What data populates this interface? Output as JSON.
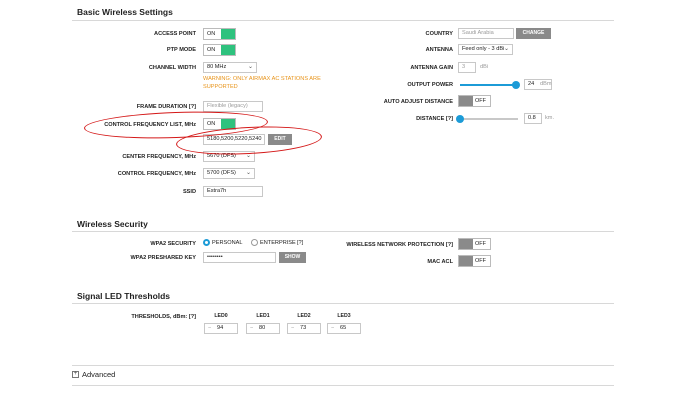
{
  "basic": {
    "title": "Basic Wireless Settings",
    "access_point_label": "ACCESS POINT",
    "access_point_state": "ON",
    "ptp_mode_label": "PTP MODE",
    "ptp_mode_state": "ON",
    "channel_width_label": "CHANNEL WIDTH",
    "channel_width_value": "80 MHz",
    "warning_line1": "WARNING: ONLY AIRMAX AC STATIONS ARE",
    "warning_line2": "SUPPORTED",
    "frame_duration_label": "FRAME DURATION [?]",
    "frame_duration_value": "Flexible (legacy)",
    "control_freq_list_label": "CONTROL FREQUENCY LIST, MHz",
    "control_freq_list_state": "ON",
    "control_freq_list_value": "5180,5200,5220,5240",
    "edit_label": "EDIT",
    "center_freq_label": "CENTER FREQUENCY, MHz",
    "center_freq_value": "5670 (DFS)",
    "control_freq_label": "CONTROL FREQUENCY, MHz",
    "control_freq_value": "5700 (DFS)",
    "ssid_label": "SSID",
    "ssid_value": "Estra7h",
    "country_label": "COUNTRY",
    "country_value": "Saudi Arabia",
    "change_label": "CHANGE",
    "antenna_label": "ANTENNA",
    "antenna_value": "Feed only - 3 dBi",
    "antenna_gain_label": "ANTENNA GAIN",
    "antenna_gain_value": "3",
    "antenna_gain_unit": "dBi",
    "output_power_label": "OUTPUT POWER",
    "output_power_value": "24",
    "output_power_unit": "dBm",
    "output_power_level": 0.96,
    "auto_adjust_label": "AUTO ADJUST DISTANCE",
    "auto_adjust_state": "OFF",
    "distance_label": "DISTANCE [?]",
    "distance_value": "0.8",
    "distance_unit": "km.",
    "distance_level": 0.0
  },
  "security": {
    "title": "Wireless Security",
    "wpa2_label": "WPA2 SECURITY",
    "personal_label": "PERSONAL",
    "enterprise_label": "ENTERPRISE",
    "enterprise_help": "[?]",
    "key_label": "WPA2 PRESHARED KEY",
    "key_value": "••••••••",
    "show_label": "SHOW",
    "wnp_label": "WIRELESS NETWORK PROTECTION [?]",
    "wnp_state": "OFF",
    "mac_acl_label": "MAC ACL",
    "mac_acl_state": "OFF"
  },
  "led": {
    "title": "Signal LED Thresholds",
    "thresholds_label": "THRESHOLDS, dBm: [?]",
    "items": [
      {
        "name": "LED0",
        "value": "94"
      },
      {
        "name": "LED1",
        "value": "80"
      },
      {
        "name": "LED2",
        "value": "73"
      },
      {
        "name": "LED3",
        "value": "65"
      }
    ],
    "minus": "−"
  },
  "advanced": {
    "expand_icon": "+",
    "label": "Advanced"
  },
  "colors": {
    "toggle_on": "#2ec27e",
    "toggle_off": "#8a8a8a",
    "accent": "#1c9bd7",
    "warning": "#e8941a",
    "annotation": "#d41818"
  }
}
